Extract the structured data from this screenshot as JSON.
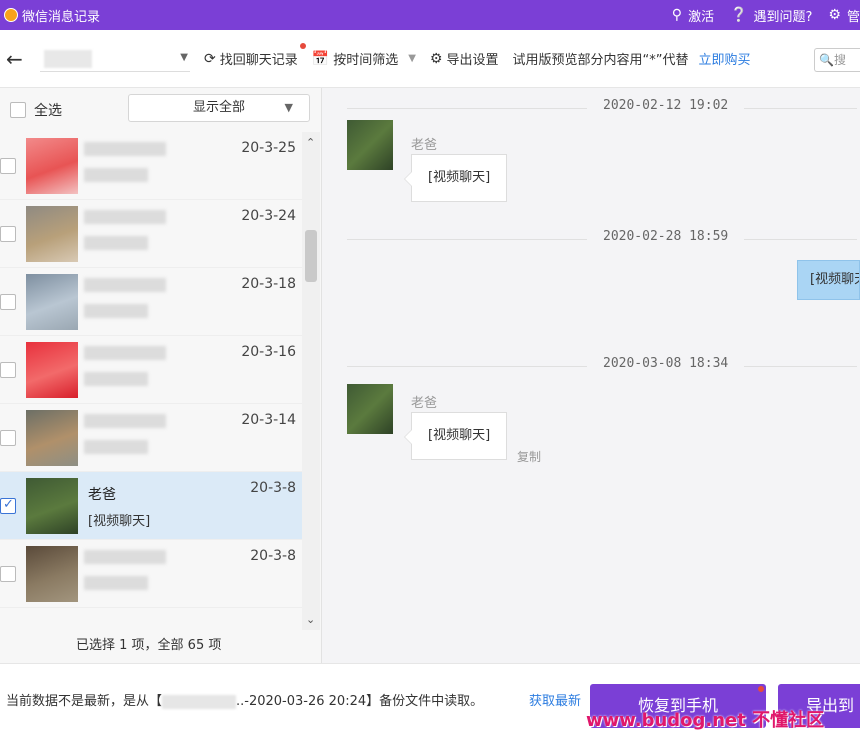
{
  "titlebar": {
    "title": "微信消息记录",
    "activate": "激活",
    "help": "遇到问题?",
    "manage": "管"
  },
  "toolbar": {
    "recover_chat": "找回聊天记录",
    "filter_by_time": "按时间筛选",
    "export_settings": "导出设置",
    "trial_notice": "试用版预览部分内容用“*”代替",
    "buy_now": "立即购买",
    "search_placeholder": "搜"
  },
  "left": {
    "select_all": "全选",
    "show_all": "显示全部",
    "status": "已选择 1 项，全部 65 项",
    "chats": [
      {
        "name": "",
        "preview": "",
        "date": "20-3-25",
        "selected": false,
        "colors": [
          "#f28a8a",
          "#e85454",
          "#f3c2c2"
        ]
      },
      {
        "name": "",
        "preview": "",
        "date": "20-3-24",
        "selected": false,
        "colors": [
          "#8f8a82",
          "#b8a07a",
          "#d8c9b4"
        ]
      },
      {
        "name": "",
        "preview": "",
        "date": "20-3-18",
        "selected": false,
        "colors": [
          "#7e8fa0",
          "#b9c6d2",
          "#9aa7b2"
        ]
      },
      {
        "name": "",
        "preview": "",
        "date": "20-3-16",
        "selected": false,
        "colors": [
          "#e8313d",
          "#f26a6a",
          "#d81f2b"
        ]
      },
      {
        "name": "",
        "preview": "",
        "date": "20-3-14",
        "selected": false,
        "colors": [
          "#6c6f66",
          "#b0906a",
          "#8d8f85"
        ]
      },
      {
        "name": "老爸",
        "preview": "[视频聊天]",
        "date": "20-3-8",
        "selected": true,
        "colors": [
          "#3f5a34",
          "#5b7a3e",
          "#2e4226"
        ]
      },
      {
        "name": "",
        "preview": "",
        "date": "20-3-8",
        "selected": false,
        "colors": [
          "#5a4a3a",
          "#8a7a62",
          "#a2957e"
        ]
      }
    ]
  },
  "messages": {
    "dividers": [
      "2020-02-12 19:02",
      "2020-02-28 18:59",
      "2020-03-08 18:34"
    ],
    "sender": "老爸",
    "video_chat": "[视频聊天]",
    "right_bubble": "[视频聊天]",
    "copy": "复制"
  },
  "footer": {
    "notice_prefix": "当前数据不是最新，是从【",
    "notice_suffix": "..-2020-03-26 20:24】备份文件中读取。",
    "fetch_latest": "获取最新",
    "restore_button": "恢复到手机",
    "export_button": "导出到",
    "watermark": "www.budog.net 不懂社区"
  }
}
